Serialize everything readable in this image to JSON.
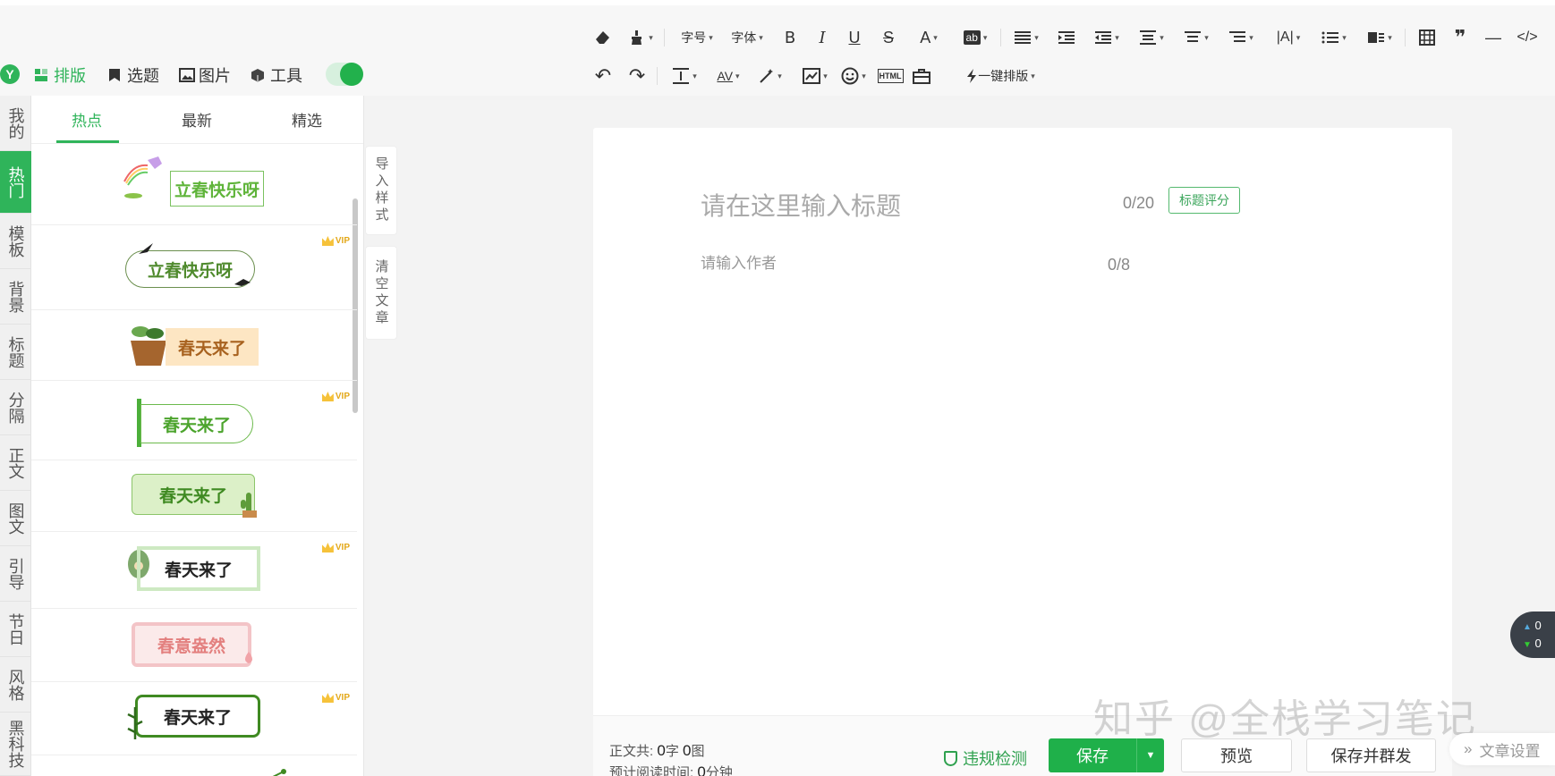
{
  "nav": {
    "logo": "Y",
    "tabs": [
      "排版",
      "选题",
      "图片",
      "工具"
    ]
  },
  "toolbar": {
    "row1": {
      "font_size": "字号",
      "font_family": "字体",
      "bold": "B",
      "italic": "I",
      "underline": "U",
      "strike": "S",
      "font_color": "A",
      "bg_color": "ab",
      "quote": "❞",
      "hr": "—",
      "code": "</>"
    },
    "row2": {
      "undo": "↶",
      "redo": "↷",
      "letter_spacing": "AV",
      "html": "HTML",
      "one_click": "一键排版"
    }
  },
  "vertical_tabs": [
    "我的",
    "热门",
    "模板",
    "背景",
    "标题",
    "分隔",
    "正文",
    "图文",
    "引导",
    "节日",
    "风格",
    "黑科技"
  ],
  "panel": {
    "tabs": [
      "热点",
      "最新",
      "精选"
    ],
    "items": [
      {
        "text": "立春快乐呀",
        "vip": false
      },
      {
        "text": "立春快乐呀",
        "vip": true
      },
      {
        "text": "春天来了",
        "vip": false
      },
      {
        "text": "春天来了",
        "vip": true
      },
      {
        "text": "春天来了",
        "vip": false
      },
      {
        "text": "春天来了",
        "vip": true
      },
      {
        "text": "春意盎然",
        "vip": false
      },
      {
        "text": "春天来了",
        "vip": true
      }
    ],
    "vip_label": "VIP"
  },
  "side_buttons": [
    "导入样式",
    "清空文章"
  ],
  "editor": {
    "title_placeholder": "请在这里输入标题",
    "title_count": "0/20",
    "score_button": "标题评分",
    "author_placeholder": "请输入作者",
    "author_count": "0/8"
  },
  "bottom": {
    "body_label": "正文共:",
    "chars": "0",
    "chars_unit": "字",
    "images": "0",
    "images_unit": "图",
    "read_label": "预计阅读时间:",
    "read_time": "0",
    "read_unit": "分钟",
    "check": "违规检测",
    "save": "保存",
    "preview": "预览",
    "save_send": "保存并群发"
  },
  "article_settings": "文章设置",
  "float_stats": {
    "up": "0",
    "down": "0"
  },
  "watermark": "知乎 @全栈学习笔记",
  "colors": {
    "accent": "#2fb45a",
    "save": "#1fb04a"
  }
}
